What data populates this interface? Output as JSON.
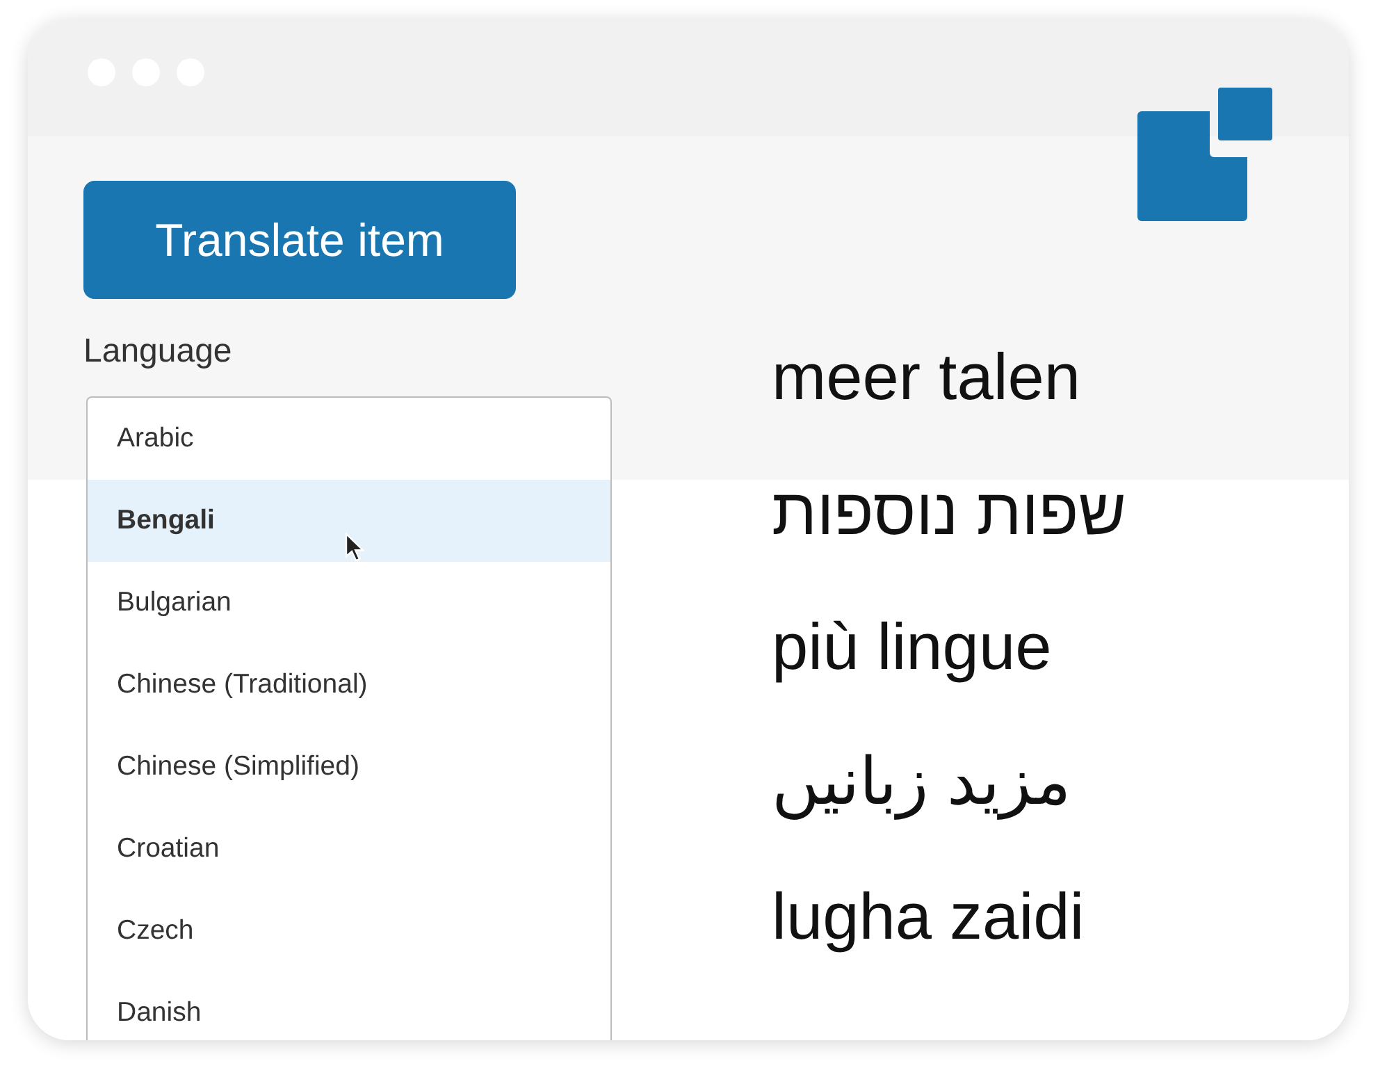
{
  "translate_button": {
    "label": "Translate item"
  },
  "language": {
    "label": "Language",
    "options": [
      {
        "label": "Arabic",
        "selected": false
      },
      {
        "label": "Bengali",
        "selected": true
      },
      {
        "label": "Bulgarian",
        "selected": false
      },
      {
        "label": "Chinese (Traditional)",
        "selected": false
      },
      {
        "label": "Chinese (Simplified)",
        "selected": false
      },
      {
        "label": "Croatian",
        "selected": false
      },
      {
        "label": "Czech",
        "selected": false
      },
      {
        "label": "Danish",
        "selected": false
      }
    ]
  },
  "phrases": [
    "meer talen",
    "שפות נוספות",
    "più lingue",
    "مزيد زبانیں",
    "lugha zaidi"
  ]
}
